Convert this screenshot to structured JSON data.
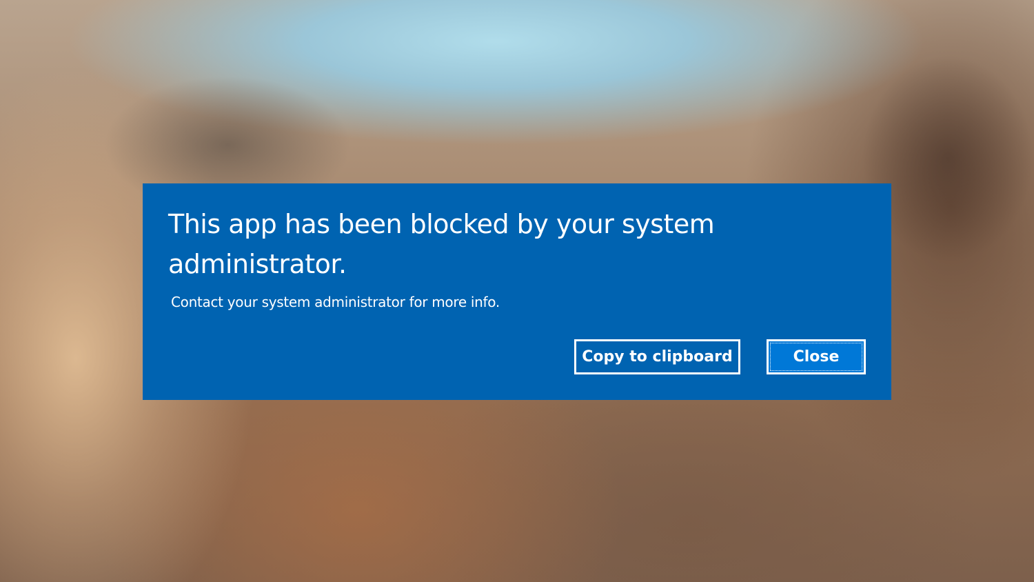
{
  "dialog": {
    "title": "This app has been blocked by your system administrator.",
    "message": "Contact your system administrator for more info.",
    "background_color": "#0063b1",
    "buttons": {
      "copy_label": "Copy to clipboard",
      "close_label": "Close",
      "close_focused": true,
      "close_color": "#0078d7"
    }
  }
}
